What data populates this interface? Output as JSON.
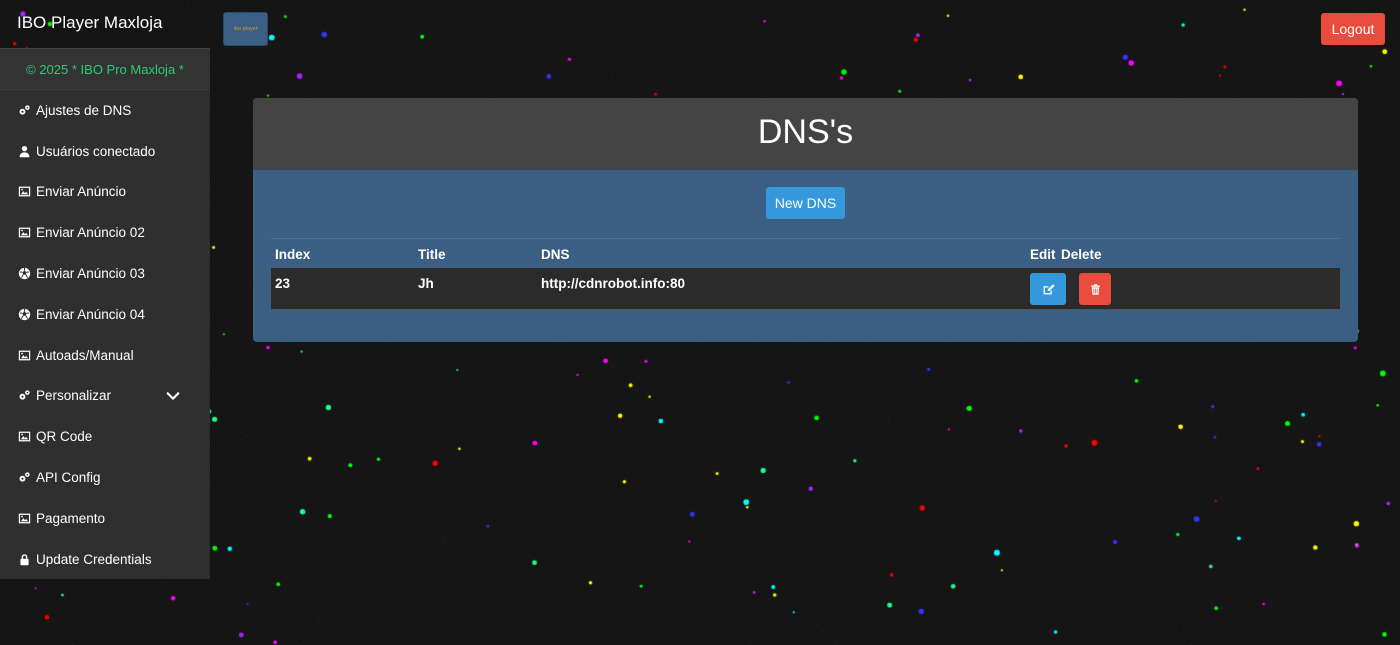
{
  "app": {
    "title": "IBO Player Maxloja",
    "logo_text": "ibo player"
  },
  "header": {
    "logout_label": "Logout"
  },
  "sidebar": {
    "copyright": "© 2025 * IBO Pro Maxloja *",
    "items": [
      {
        "label": "Ajustes de DNS",
        "icon": "gears-icon"
      },
      {
        "label": "Usuários conectado",
        "icon": "user-icon"
      },
      {
        "label": "Enviar Anúncio",
        "icon": "image-icon"
      },
      {
        "label": "Enviar Anúncio 02",
        "icon": "image-icon"
      },
      {
        "label": "Enviar Anúncio 03",
        "icon": "soccer-ball-icon"
      },
      {
        "label": "Enviar Anúncio 04",
        "icon": "soccer-ball-icon"
      },
      {
        "label": "Autoads/Manual",
        "icon": "image-icon"
      },
      {
        "label": "Personalizar",
        "icon": "gears-icon"
      },
      {
        "label": "QR Code",
        "icon": "image-icon"
      },
      {
        "label": "API Config",
        "icon": "gears-icon"
      },
      {
        "label": "Pagamento",
        "icon": "image-icon"
      },
      {
        "label": "Update Credentials",
        "icon": "lock-icon"
      }
    ]
  },
  "main": {
    "title": "DNS's",
    "new_button": "New DNS",
    "columns": {
      "index": "Index",
      "title": "Title",
      "dns": "DNS",
      "edit": "Edit",
      "delete": "Delete"
    },
    "rows": [
      {
        "index": "23",
        "title": "Jh",
        "dns": "http://cdnrobot.info:80"
      }
    ]
  },
  "colors": {
    "accent_blue": "#3498db",
    "danger_red": "#e74c3c",
    "copyright_green": "#2ecc71",
    "panel_blue": "#3a5f82"
  }
}
